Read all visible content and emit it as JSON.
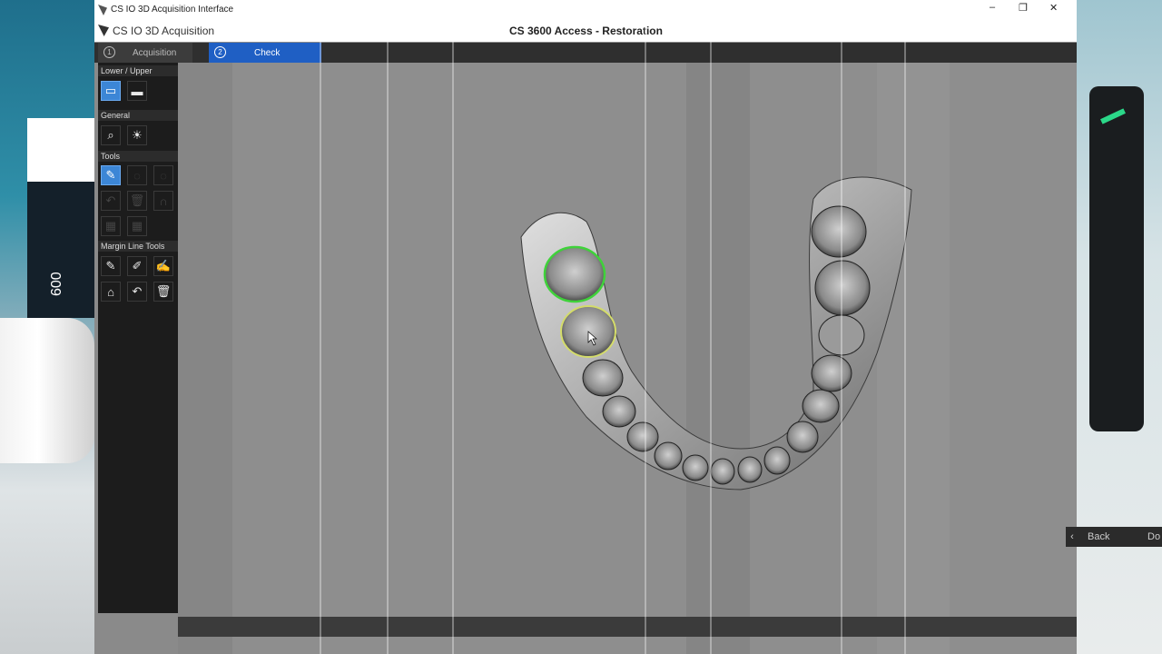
{
  "window": {
    "title": "CS IO 3D Acquisition Interface",
    "controls": {
      "minimize": "–",
      "restore": "❐",
      "close": "✕"
    }
  },
  "header": {
    "logo": "CS IO 3D Acquisition",
    "main_title": "CS 3600 Access - Restoration"
  },
  "steps": [
    {
      "number": "1",
      "label": "Acquisition",
      "active": false
    },
    {
      "number": "2",
      "label": "Check",
      "active": true
    }
  ],
  "sidebar": {
    "sections": [
      {
        "label": "Lower / Upper"
      },
      {
        "label": "General"
      },
      {
        "label": "Tools"
      },
      {
        "label": "Margin Line Tools"
      }
    ]
  },
  "footer": {
    "back_label": "Back",
    "next_partial": "Do"
  },
  "colors": {
    "accent": "#1f5fc4",
    "tool_active": "#3c86d6",
    "margin_green": "#3fd23a",
    "margin_yellow": "#d4dc6a"
  },
  "background": {
    "device_label": "600"
  }
}
